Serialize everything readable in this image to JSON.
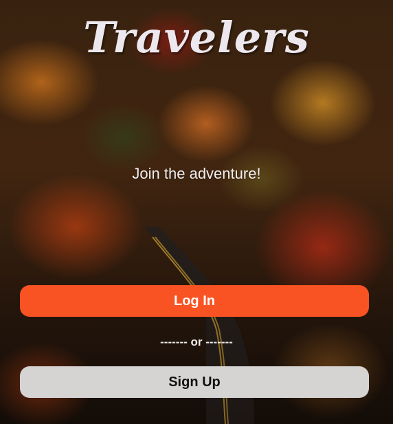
{
  "app": {
    "logo_text": "Travelers",
    "tagline": "Join the adventure!"
  },
  "actions": {
    "login_label": "Log In",
    "divider_text": "------- or -------",
    "signup_label": "Sign Up"
  },
  "colors": {
    "login_bg": "#fa5323",
    "signup_bg": "#d6d3d3",
    "text_light": "#ece8ee"
  },
  "background": {
    "image_subject": "autumn-forest-road-photo"
  }
}
